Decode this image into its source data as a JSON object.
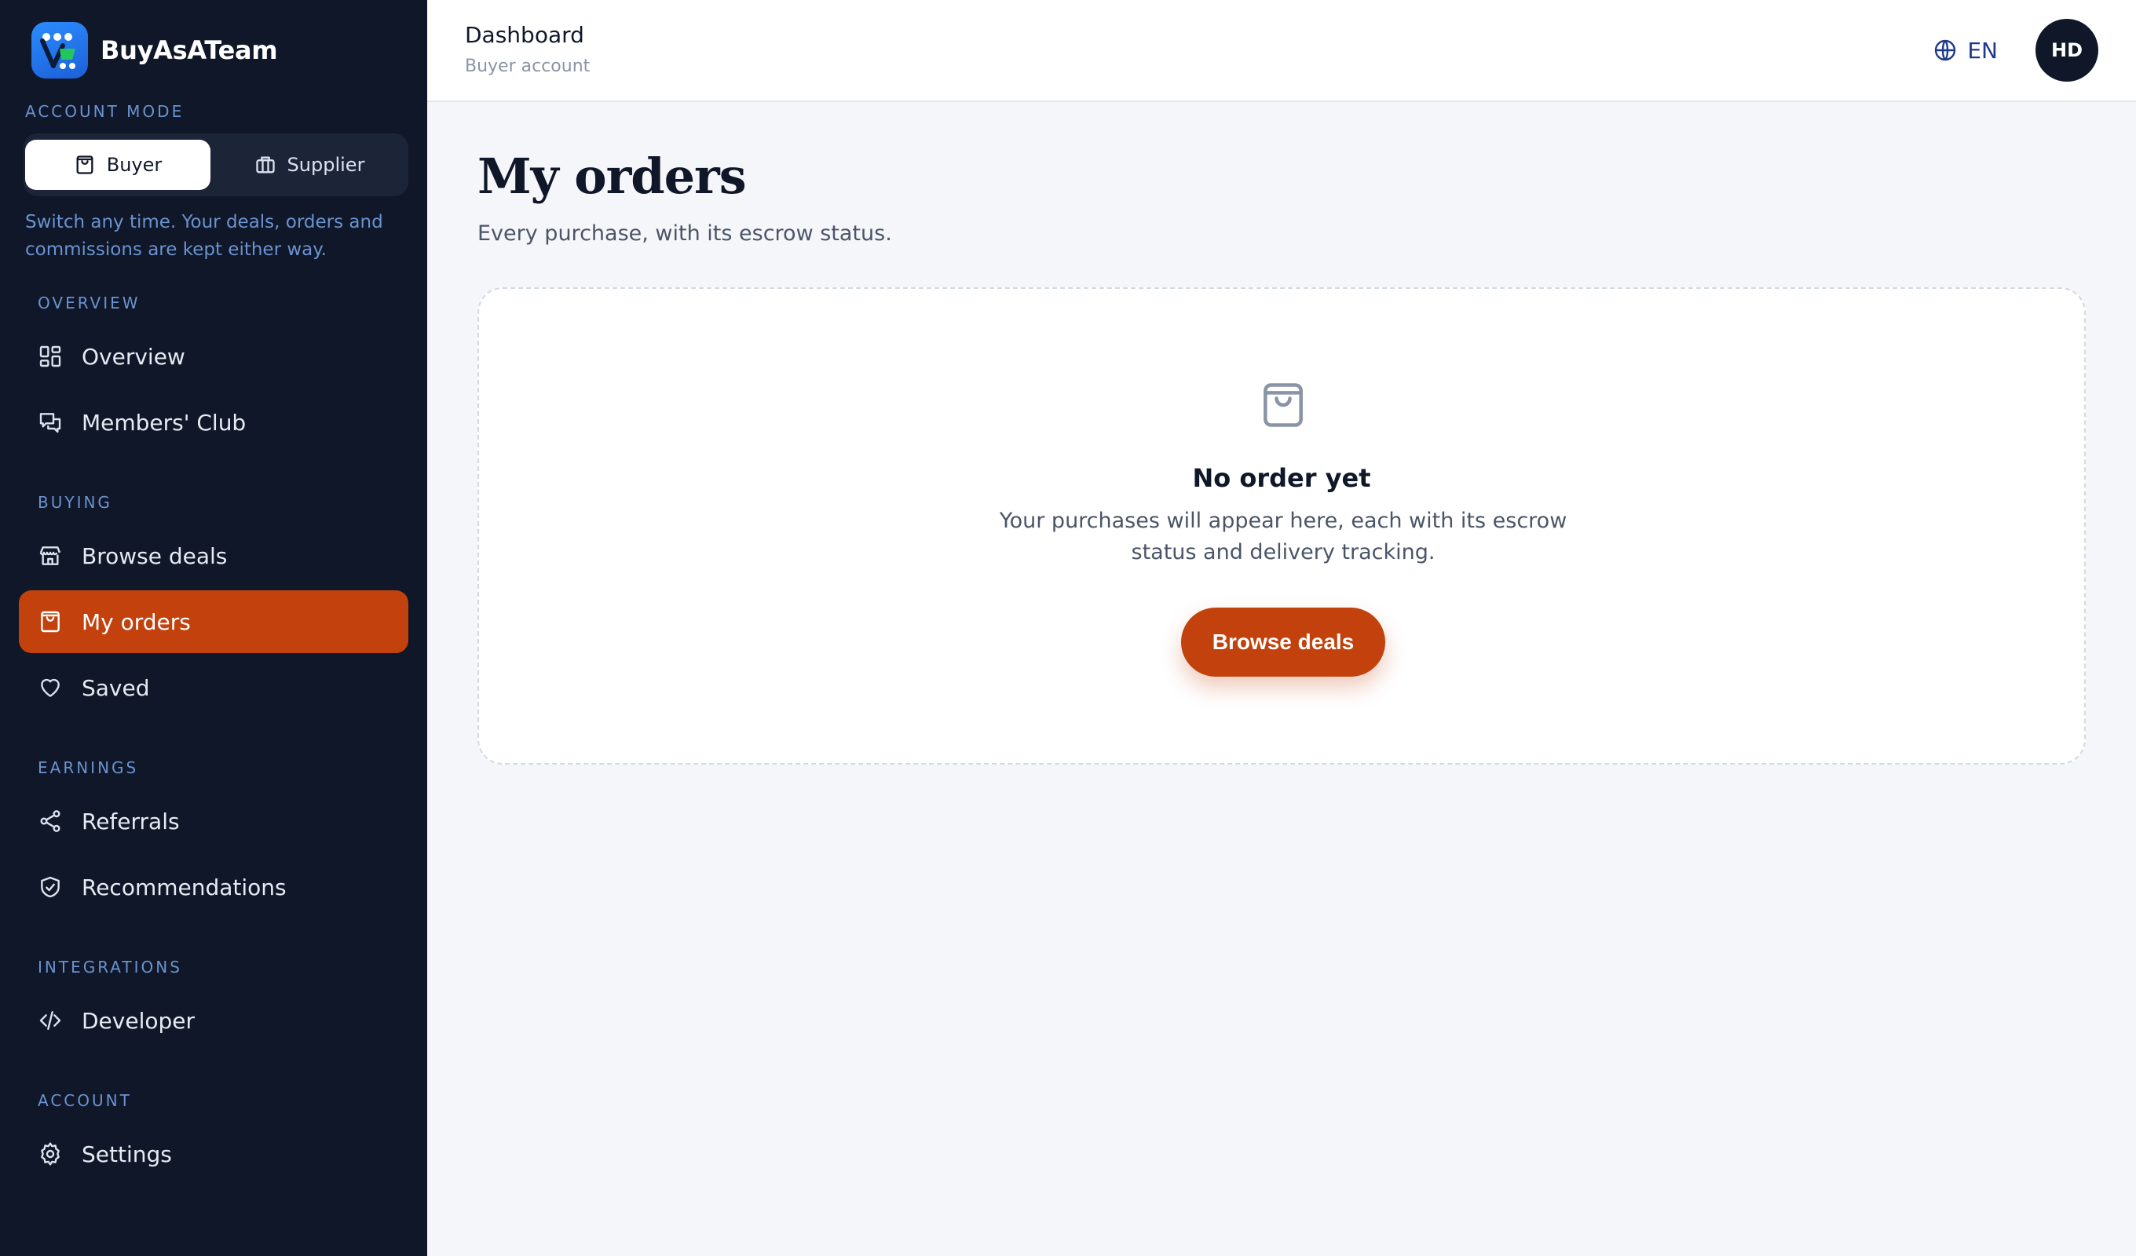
{
  "brand": {
    "name": "BuyAsATeam"
  },
  "account_mode": {
    "label": "ACCOUNT MODE",
    "buyer": "Buyer",
    "supplier": "Supplier",
    "help": "Switch any time. Your deals, orders and commissions are kept either way."
  },
  "sidebar": {
    "sections": {
      "overview": "OVERVIEW",
      "buying": "BUYING",
      "earnings": "EARNINGS",
      "integrations": "INTEGRATIONS",
      "account": "ACCOUNT"
    },
    "items": {
      "overview": "Overview",
      "members_club": "Members' Club",
      "browse_deals": "Browse deals",
      "my_orders": "My orders",
      "saved": "Saved",
      "referrals": "Referrals",
      "recommendations": "Recommendations",
      "developer": "Developer",
      "settings": "Settings"
    }
  },
  "header": {
    "title": "Dashboard",
    "subtitle": "Buyer account",
    "language": "EN",
    "avatar_initials": "HD"
  },
  "main": {
    "title": "My orders",
    "subtitle": "Every purchase, with its escrow status.",
    "empty": {
      "title": "No order yet",
      "text": "Your purchases will appear here, each with its escrow status and delivery tracking.",
      "button": "Browse deals"
    }
  },
  "colors": {
    "sidebar_bg": "#0f1729",
    "accent": "#c2410c",
    "section_label": "#6b93cf"
  }
}
